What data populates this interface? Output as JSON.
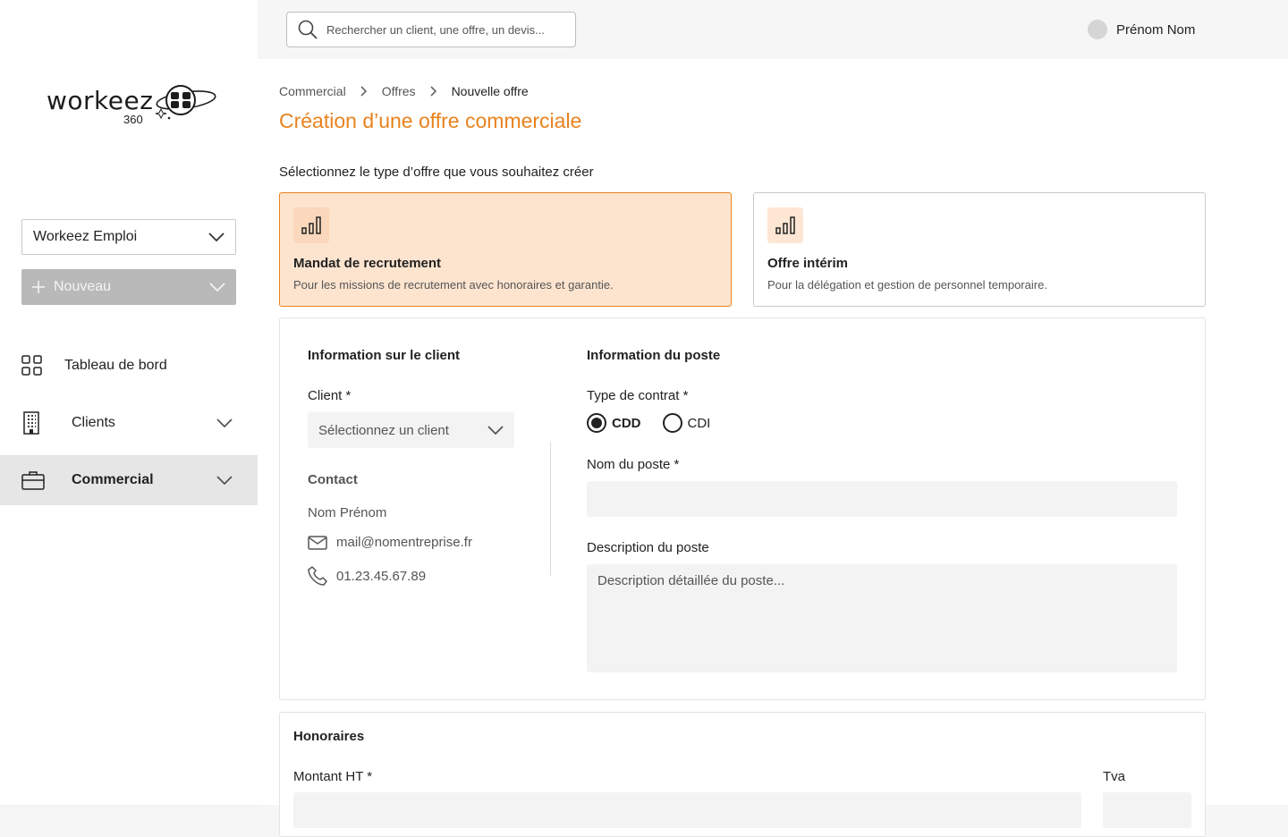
{
  "sidebar": {
    "logo": {
      "word": "workeez",
      "sub": "360"
    },
    "company": "Workeez Emploi",
    "new_button": "Nouveau",
    "items": [
      {
        "label": "Tableau de bord",
        "icon": "dashboard-grid-icon"
      },
      {
        "label": "Clients",
        "icon": "building-icon"
      },
      {
        "label": "Commercial",
        "icon": "briefcase-icon",
        "active": true
      }
    ]
  },
  "topbar": {
    "search_placeholder": "Rechercher un client, une offre, un devis...",
    "user_name": "Prénom Nom"
  },
  "breadcrumb": [
    "Commercial",
    "Offres",
    "Nouvelle offre"
  ],
  "page_title": "Création d’une offre commerciale",
  "prompt": "Sélectionnez le type d’offre que vous souhaitez créer",
  "offer_types": [
    {
      "title": "Mandat de recrutement",
      "desc": "Pour les missions de recrutement avec honoraires et garantie.",
      "selected": true
    },
    {
      "title": "Offre intérim",
      "desc": "Pour la délégation et gestion de personnel temporaire.",
      "selected": false
    }
  ],
  "client_section": {
    "title": "Information sur le client",
    "client_label": "Client *",
    "client_placeholder": "Sélectionnez un client",
    "contact_title": "Contact",
    "contact_name": "Nom Prénom",
    "contact_email": "mail@nomentreprise.fr",
    "contact_phone": "01.23.45.67.89"
  },
  "job_section": {
    "title": "Information du poste",
    "contract_label": "Type de contrat *",
    "contract_options": [
      "CDD",
      "CDI"
    ],
    "contract_selected": "CDD",
    "job_name_label": "Nom du poste *",
    "job_name_value": "",
    "desc_label": "Description du poste",
    "desc_placeholder": "Description détaillée du poste..."
  },
  "fees": {
    "title": "Honoraires",
    "amount_label": "Montant HT *",
    "tva_label": "Tva"
  },
  "colors": {
    "accent": "#e8821e",
    "selected_bg": "#fde4cf",
    "input_bg": "#f3f3f3"
  }
}
